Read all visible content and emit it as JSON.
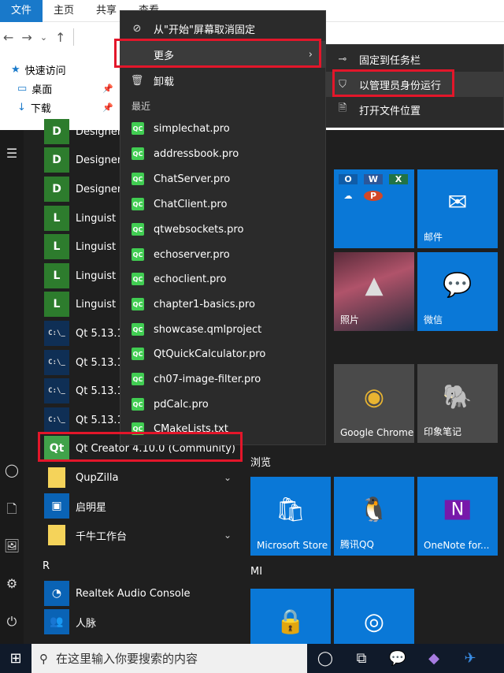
{
  "explorer": {
    "tabs": [
      "文件",
      "主页",
      "共享",
      "查看"
    ],
    "nav": [
      {
        "label": "快速访问",
        "icon": "star-icon"
      },
      {
        "label": "桌面",
        "icon": "desktop-icon"
      },
      {
        "label": "下载",
        "icon": "download-icon"
      }
    ]
  },
  "apps": [
    {
      "label": "Designer",
      "badge": "D"
    },
    {
      "label": "Designer",
      "badge": "D"
    },
    {
      "label": "Designer",
      "badge": "D"
    },
    {
      "label": "Linguist",
      "badge": "L"
    },
    {
      "label": "Linguist",
      "badge": "L"
    },
    {
      "label": "Linguist",
      "badge": "L"
    },
    {
      "label": "Linguist",
      "badge": "L"
    },
    {
      "label": "Qt 5.13.1",
      "badge": "C:\\_"
    },
    {
      "label": "Qt 5.13.1",
      "badge": "C:\\_"
    },
    {
      "label": "Qt 5.13.1",
      "badge": "C:\\_"
    },
    {
      "label": "Qt 5.13.1",
      "badge": "C:\\_"
    },
    {
      "label": "Qt Creator 4.10.0 (Community)",
      "badge": "Qt"
    },
    {
      "label": "QupZilla",
      "badge": ""
    },
    {
      "label": "启明星",
      "badge": ""
    },
    {
      "label": "千牛工作台",
      "badge": ""
    },
    {
      "label": "R",
      "badge": ""
    },
    {
      "label": "Realtek Audio Console",
      "badge": ""
    },
    {
      "label": "人脉",
      "badge": ""
    }
  ],
  "context_menu": {
    "unpin": "从\"开始\"屏幕取消固定",
    "more": "更多",
    "uninstall": "卸载",
    "recent_header": "最近",
    "recent": [
      "simplechat.pro",
      "addressbook.pro",
      "ChatServer.pro",
      "ChatClient.pro",
      "qtwebsockets.pro",
      "echoserver.pro",
      "echoclient.pro",
      "chapter1-basics.pro",
      "showcase.qmlproject",
      "QtQuickCalculator.pro",
      "ch07-image-filter.pro",
      "pdCalc.pro",
      "CMakeLists.txt"
    ],
    "recent_icon": "QC"
  },
  "submenu": {
    "pin_taskbar": "固定到任务栏",
    "run_admin": "以管理员身份运行",
    "open_location": "打开文件位置"
  },
  "tiles": {
    "groups": [
      "浏览",
      "MI"
    ],
    "items": [
      {
        "label": "邮件",
        "icon": "✉"
      },
      {
        "label": "照片",
        "icon": "▲"
      },
      {
        "label": "微信",
        "icon": "💬"
      },
      {
        "label": "Google Chrome",
        "icon": "◉"
      },
      {
        "label": "印象笔记",
        "icon": "🐘"
      },
      {
        "label": "Microsoft Store",
        "icon": "🛍"
      },
      {
        "label": "腾讯QQ",
        "icon": "🐧"
      },
      {
        "label": "OneNote for...",
        "icon": "N"
      }
    ],
    "office_icons": [
      "O",
      "W",
      "X",
      "☁",
      "P"
    ]
  },
  "taskbar": {
    "search_placeholder": "在这里输入你要搜索的内容"
  },
  "colors": {
    "accent": "#0a78d7",
    "highlight": "#e3162a",
    "qt_green": "#41cd52"
  }
}
